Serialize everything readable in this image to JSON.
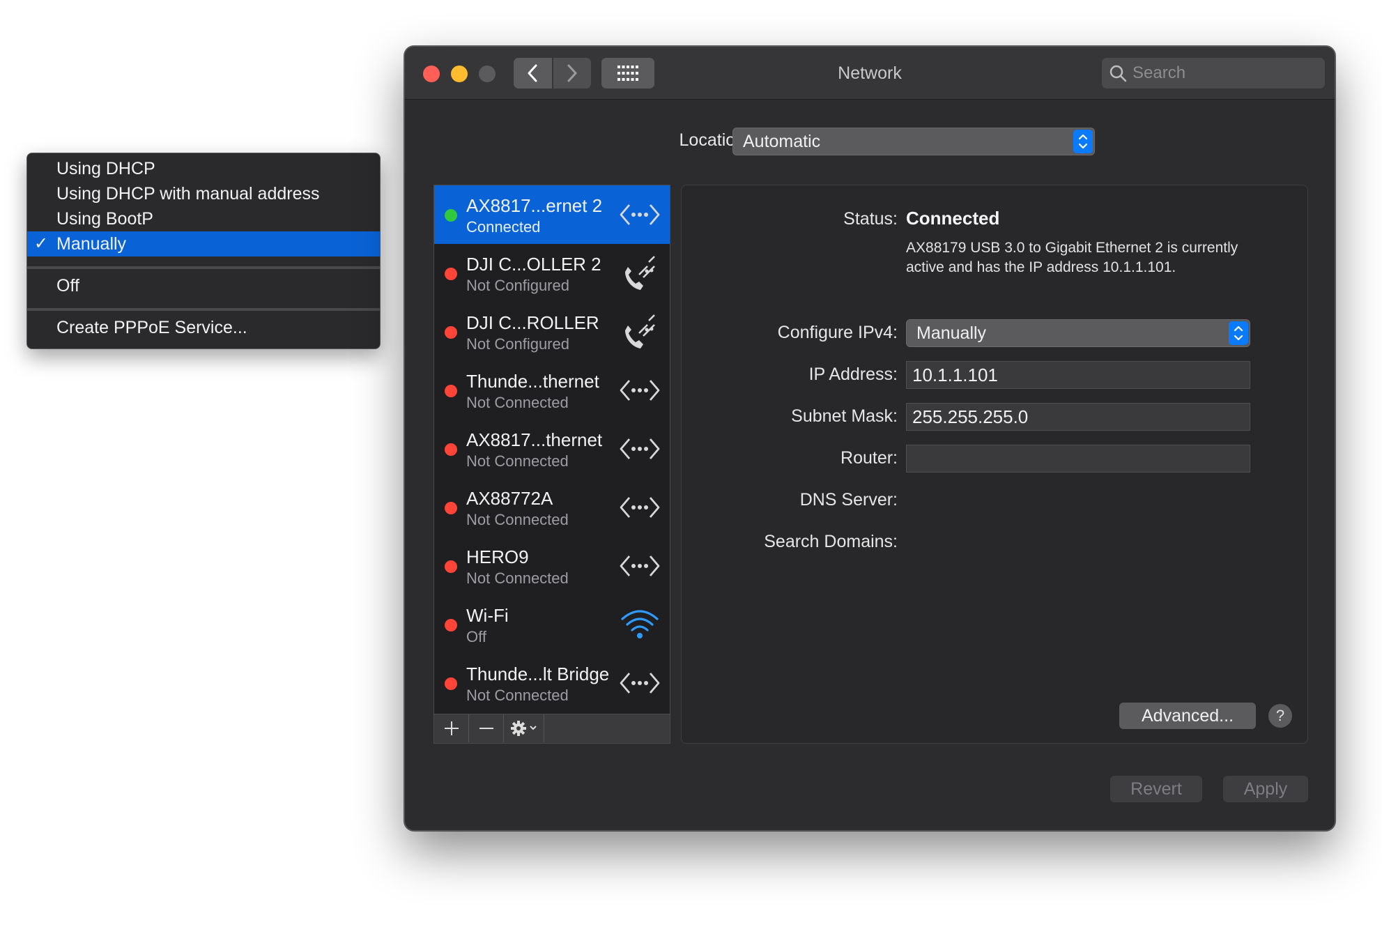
{
  "window": {
    "title": "Network",
    "search_placeholder": "Search"
  },
  "location": {
    "label": "Location:",
    "value": "Automatic"
  },
  "services": [
    {
      "name": "AX8817...ernet 2",
      "status": "Connected",
      "dot_color": "#30c93d",
      "icon": "ethernet-icon",
      "selected": true
    },
    {
      "name": "DJI    C...OLLER 2",
      "status": "Not Configured",
      "dot_color": "#ff4538",
      "icon": "phone-icon",
      "selected": false
    },
    {
      "name": "DJI    C...ROLLER",
      "status": "Not Configured",
      "dot_color": "#ff4538",
      "icon": "phone-icon",
      "selected": false
    },
    {
      "name": "Thunde...thernet",
      "status": "Not Connected",
      "dot_color": "#ff4538",
      "icon": "ethernet-icon",
      "selected": false
    },
    {
      "name": "AX8817...thernet",
      "status": "Not Connected",
      "dot_color": "#ff4538",
      "icon": "ethernet-icon",
      "selected": false
    },
    {
      "name": "AX88772A",
      "status": "Not Connected",
      "dot_color": "#ff4538",
      "icon": "ethernet-icon",
      "selected": false
    },
    {
      "name": "HERO9",
      "status": "Not Connected",
      "dot_color": "#ff4538",
      "icon": "ethernet-icon",
      "selected": false
    },
    {
      "name": "Wi-Fi",
      "status": "Off",
      "dot_color": "#ff4538",
      "icon": "wifi-icon",
      "selected": false
    },
    {
      "name": "Thunde...lt Bridge",
      "status": "Not Connected",
      "dot_color": "#ff4538",
      "icon": "ethernet-icon",
      "selected": false
    }
  ],
  "detail": {
    "status_label": "Status:",
    "status_value": "Connected",
    "status_description": "AX88179 USB 3.0 to Gigabit Ethernet 2 is currently active and has the IP address 10.1.1.101.",
    "configure_label": "Configure IPv4:",
    "configure_value": "Manually",
    "ip_label": "IP Address:",
    "ip_value": "10.1.1.101",
    "subnet_label": "Subnet Mask:",
    "subnet_value": "255.255.255.0",
    "router_label": "Router:",
    "router_value": "",
    "dns_label": "DNS Server:",
    "domains_label": "Search Domains:",
    "advanced_label": "Advanced...",
    "help_label": "?"
  },
  "buttons": {
    "revert": "Revert",
    "apply": "Apply"
  },
  "menu": {
    "items": [
      "Using DHCP",
      "Using DHCP with manual address",
      "Using BootP",
      "Manually",
      "Off",
      "Create PPPoE Service..."
    ],
    "checked": "Manually",
    "check_mark": "✓"
  },
  "colors": {
    "accent": "#0a63d6",
    "connected": "#30c93d",
    "disconnected": "#ff4538",
    "wifi": "#2f9bff"
  }
}
